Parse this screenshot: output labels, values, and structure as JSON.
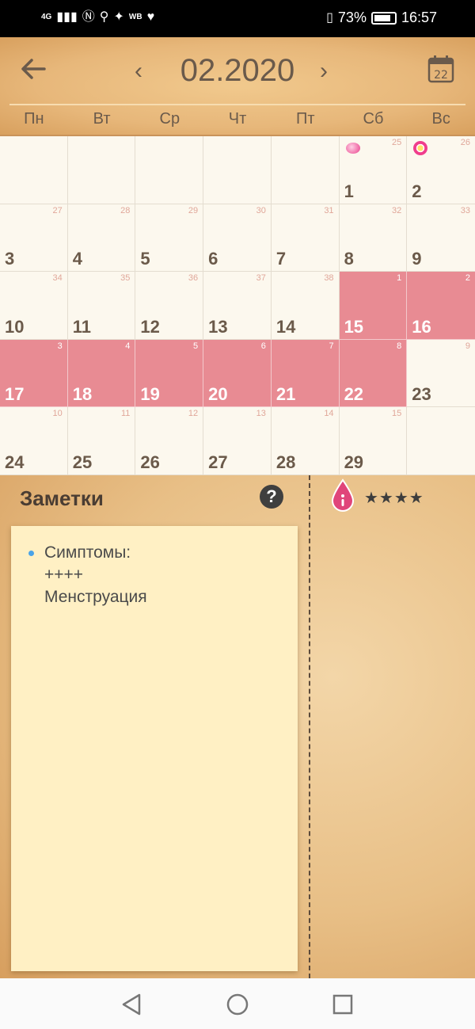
{
  "status_bar": {
    "network": "4G",
    "battery_percent": "73%",
    "time": "16:57",
    "extra_label": "WB"
  },
  "header": {
    "title": "02.2020",
    "today_day": "22",
    "weekdays": [
      "Пн",
      "Вт",
      "Ср",
      "Чт",
      "Пт",
      "Сб",
      "Вс"
    ]
  },
  "calendar": {
    "cells": [
      {
        "day": "",
        "cycle": ""
      },
      {
        "day": "",
        "cycle": ""
      },
      {
        "day": "",
        "cycle": ""
      },
      {
        "day": "",
        "cycle": ""
      },
      {
        "day": "",
        "cycle": ""
      },
      {
        "day": "1",
        "cycle": "25",
        "marker": "pink-dot"
      },
      {
        "day": "2",
        "cycle": "26",
        "marker": "flower"
      },
      {
        "day": "3",
        "cycle": "27"
      },
      {
        "day": "4",
        "cycle": "28"
      },
      {
        "day": "5",
        "cycle": "29"
      },
      {
        "day": "6",
        "cycle": "30"
      },
      {
        "day": "7",
        "cycle": "31"
      },
      {
        "day": "8",
        "cycle": "32"
      },
      {
        "day": "9",
        "cycle": "33"
      },
      {
        "day": "10",
        "cycle": "34"
      },
      {
        "day": "11",
        "cycle": "35"
      },
      {
        "day": "12",
        "cycle": "36"
      },
      {
        "day": "13",
        "cycle": "37"
      },
      {
        "day": "14",
        "cycle": "38"
      },
      {
        "day": "15",
        "cycle": "1",
        "period": true
      },
      {
        "day": "16",
        "cycle": "2",
        "period": true
      },
      {
        "day": "17",
        "cycle": "3",
        "period": true
      },
      {
        "day": "18",
        "cycle": "4",
        "period": true
      },
      {
        "day": "19",
        "cycle": "5",
        "period": true
      },
      {
        "day": "20",
        "cycle": "6",
        "period": true
      },
      {
        "day": "21",
        "cycle": "7",
        "period": true
      },
      {
        "day": "22",
        "cycle": "8",
        "period": true
      },
      {
        "day": "23",
        "cycle": "9"
      },
      {
        "day": "24",
        "cycle": "10"
      },
      {
        "day": "25",
        "cycle": "11"
      },
      {
        "day": "26",
        "cycle": "12"
      },
      {
        "day": "27",
        "cycle": "13"
      },
      {
        "day": "28",
        "cycle": "14"
      },
      {
        "day": "29",
        "cycle": "15"
      },
      {
        "day": "",
        "cycle": ""
      }
    ]
  },
  "notes": {
    "title": "Заметки",
    "help": "?",
    "stars": "★★★★",
    "items": [
      {
        "lines": [
          "Симптомы:",
          "++++",
          "Менструация"
        ]
      }
    ]
  },
  "colors": {
    "period": "#e88b93",
    "text_brown": "#6b5a4a",
    "cycle_number": "#e0a79a"
  }
}
